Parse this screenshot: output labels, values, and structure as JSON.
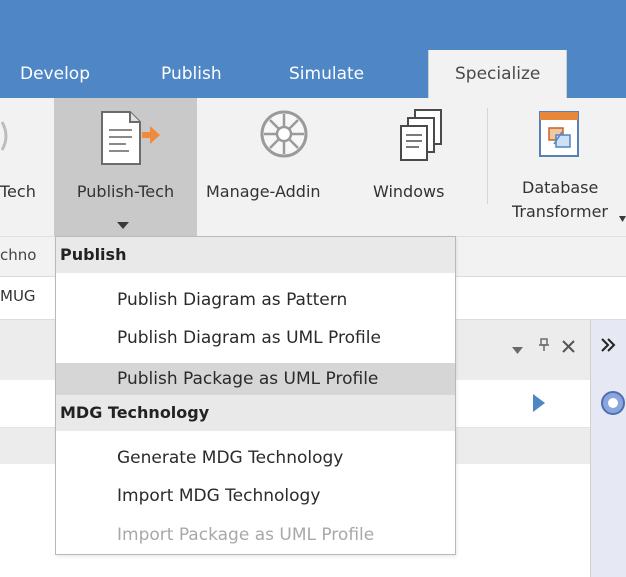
{
  "tabs": [
    {
      "label": "Develop"
    },
    {
      "label": "Publish"
    },
    {
      "label": "Simulate"
    },
    {
      "label": "Specialize",
      "active": true
    }
  ],
  "ribbon": {
    "cut_left_label": "Tech",
    "publish_tech": {
      "label": "Publish-Tech",
      "icon": "publish-document-arrow-icon"
    },
    "manage_addin": {
      "label": "Manage-Addin",
      "icon": "wheel-gear-icon"
    },
    "windows": {
      "label": "Windows",
      "icon": "stacked-windows-icon"
    },
    "database_transformer": {
      "line1": "Database",
      "line2": "Transformer",
      "icon": "database-transform-icon"
    }
  },
  "group_label_cut": "chno",
  "row_label_cut": "MUG",
  "menu": {
    "sections": [
      {
        "header": "Publish",
        "items": [
          {
            "label": "Publish Diagram as Pattern",
            "state": "normal"
          },
          {
            "label": "Publish Diagram as UML Profile",
            "state": "normal"
          },
          {
            "label": "Publish Package as UML Profile",
            "state": "hover"
          }
        ]
      },
      {
        "header": "MDG Technology",
        "items": [
          {
            "label": "Generate MDG Technology",
            "state": "normal"
          },
          {
            "label": "Import MDG Technology",
            "state": "normal"
          },
          {
            "label": "Import Package as UML Profile",
            "state": "disabled"
          }
        ]
      }
    ]
  },
  "panel_controls": {
    "dropdown_icon": "chevron-down-icon",
    "pin_icon": "pin-icon",
    "close_icon": "close-icon",
    "expand_icon": "double-chevron-right-icon",
    "play_icon": "play-triangle-icon"
  },
  "colors": {
    "ribbon_tab_bar": "#4f86c6",
    "ribbon_body": "#f2f2f2",
    "pressed_button": "#c9c9c9",
    "menu_hover": "#d6d6d6",
    "accent_blue": "#4f86c6",
    "disabled_text": "#a8a8a8"
  }
}
